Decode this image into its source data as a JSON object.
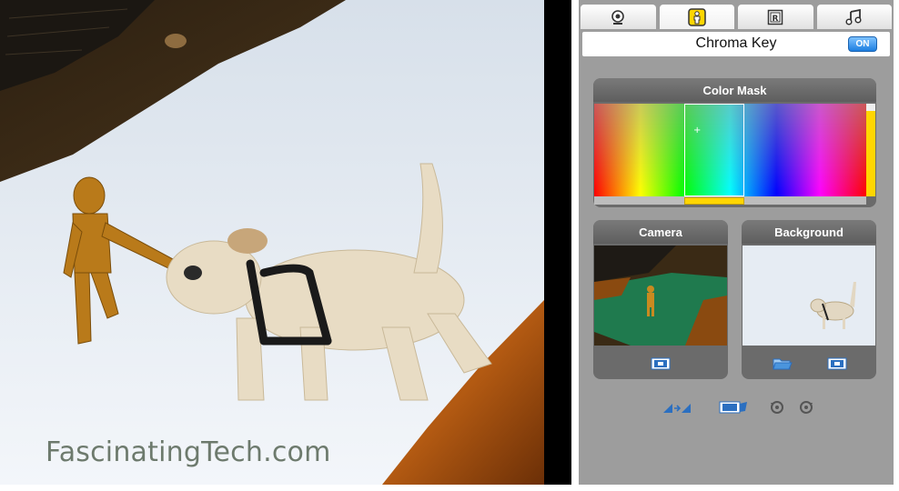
{
  "preview": {
    "watermark": "FascinatingTech.com"
  },
  "tabs": [
    {
      "icon": "webcam-icon"
    },
    {
      "icon": "person-icon",
      "active": true
    },
    {
      "icon": "registered-frame-icon"
    },
    {
      "icon": "music-notes-icon"
    }
  ],
  "effect": {
    "name": "Chroma Key",
    "toggle_label": "ON"
  },
  "color_mask": {
    "title": "Color Mask"
  },
  "camera": {
    "title": "Camera"
  },
  "background": {
    "title": "Background"
  },
  "colors": {
    "panel_bg": "#9d9d9d",
    "box_bg": "#6b6b6b",
    "toggle_blue": "#1c7ee0",
    "slider_yellow": "#ffd600"
  }
}
